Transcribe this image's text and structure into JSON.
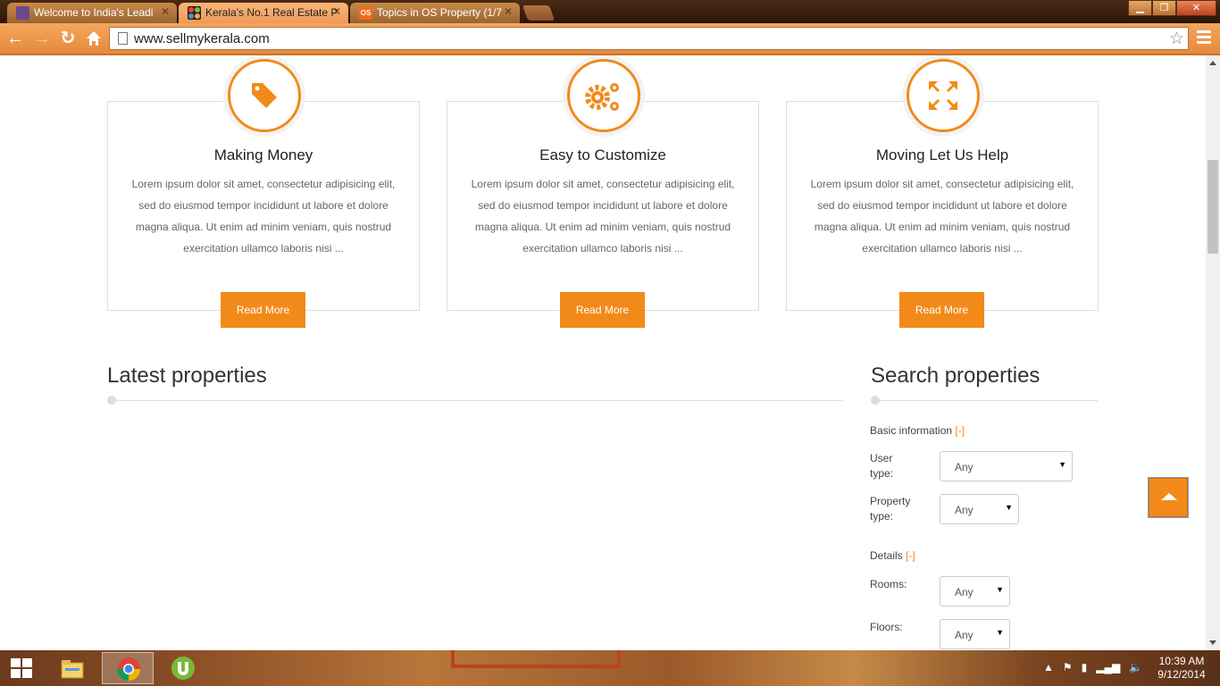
{
  "browser": {
    "tabs": [
      {
        "title": "Welcome to India's Leadi",
        "active": false,
        "favicon": "site-logo-icon"
      },
      {
        "title": "Kerala's No.1 Real Estate P",
        "active": true,
        "favicon": "joomla-icon"
      },
      {
        "title": "Topics in OS Property (1/7",
        "active": false,
        "favicon": "os-property-icon"
      }
    ],
    "url": "www.sellmykerala.com"
  },
  "features": [
    {
      "title": "Making Money",
      "icon": "price-tag-icon",
      "text": "Lorem ipsum dolor sit amet, consectetur adipisicing elit, sed do eiusmod tempor incididunt ut labore et dolore magna aliqua. Ut enim ad minim veniam, quis nostrud exercitation ullamco laboris nisi ...",
      "button": "Read More"
    },
    {
      "title": "Easy to Customize",
      "icon": "gears-icon",
      "text": "Lorem ipsum dolor sit amet, consectetur adipisicing elit, sed do eiusmod tempor incididunt ut labore et dolore magna aliqua. Ut enim ad minim veniam, quis nostrud exercitation ullamco laboris nisi ...",
      "button": "Read More"
    },
    {
      "title": "Moving Let Us Help",
      "icon": "expand-arrows-icon",
      "text": "Lorem ipsum dolor sit amet, consectetur adipisicing elit, sed do eiusmod tempor incididunt ut labore et dolore magna aliqua. Ut enim ad minim veniam, quis nostrud exercitation ullamco laboris nisi ...",
      "button": "Read More"
    }
  ],
  "latest": {
    "title": "Latest properties"
  },
  "search": {
    "title": "Search properties",
    "basic_label": "Basic information",
    "basic_toggle": "[-]",
    "user_type_label_1": "User",
    "user_type_label_2": "type:",
    "user_type_value": "Any",
    "property_type_label_1": "Property",
    "property_type_label_2": "type:",
    "property_type_value": "Any",
    "details_label": "Details",
    "details_toggle": "[-]",
    "rooms_label": "Rooms:",
    "rooms_value": "Any",
    "floors_label": "Floors:",
    "floors_value": "Any"
  },
  "taskbar": {
    "time": "10:39 AM",
    "date": "9/12/2014"
  },
  "colors": {
    "accent": "#f28a1a"
  }
}
